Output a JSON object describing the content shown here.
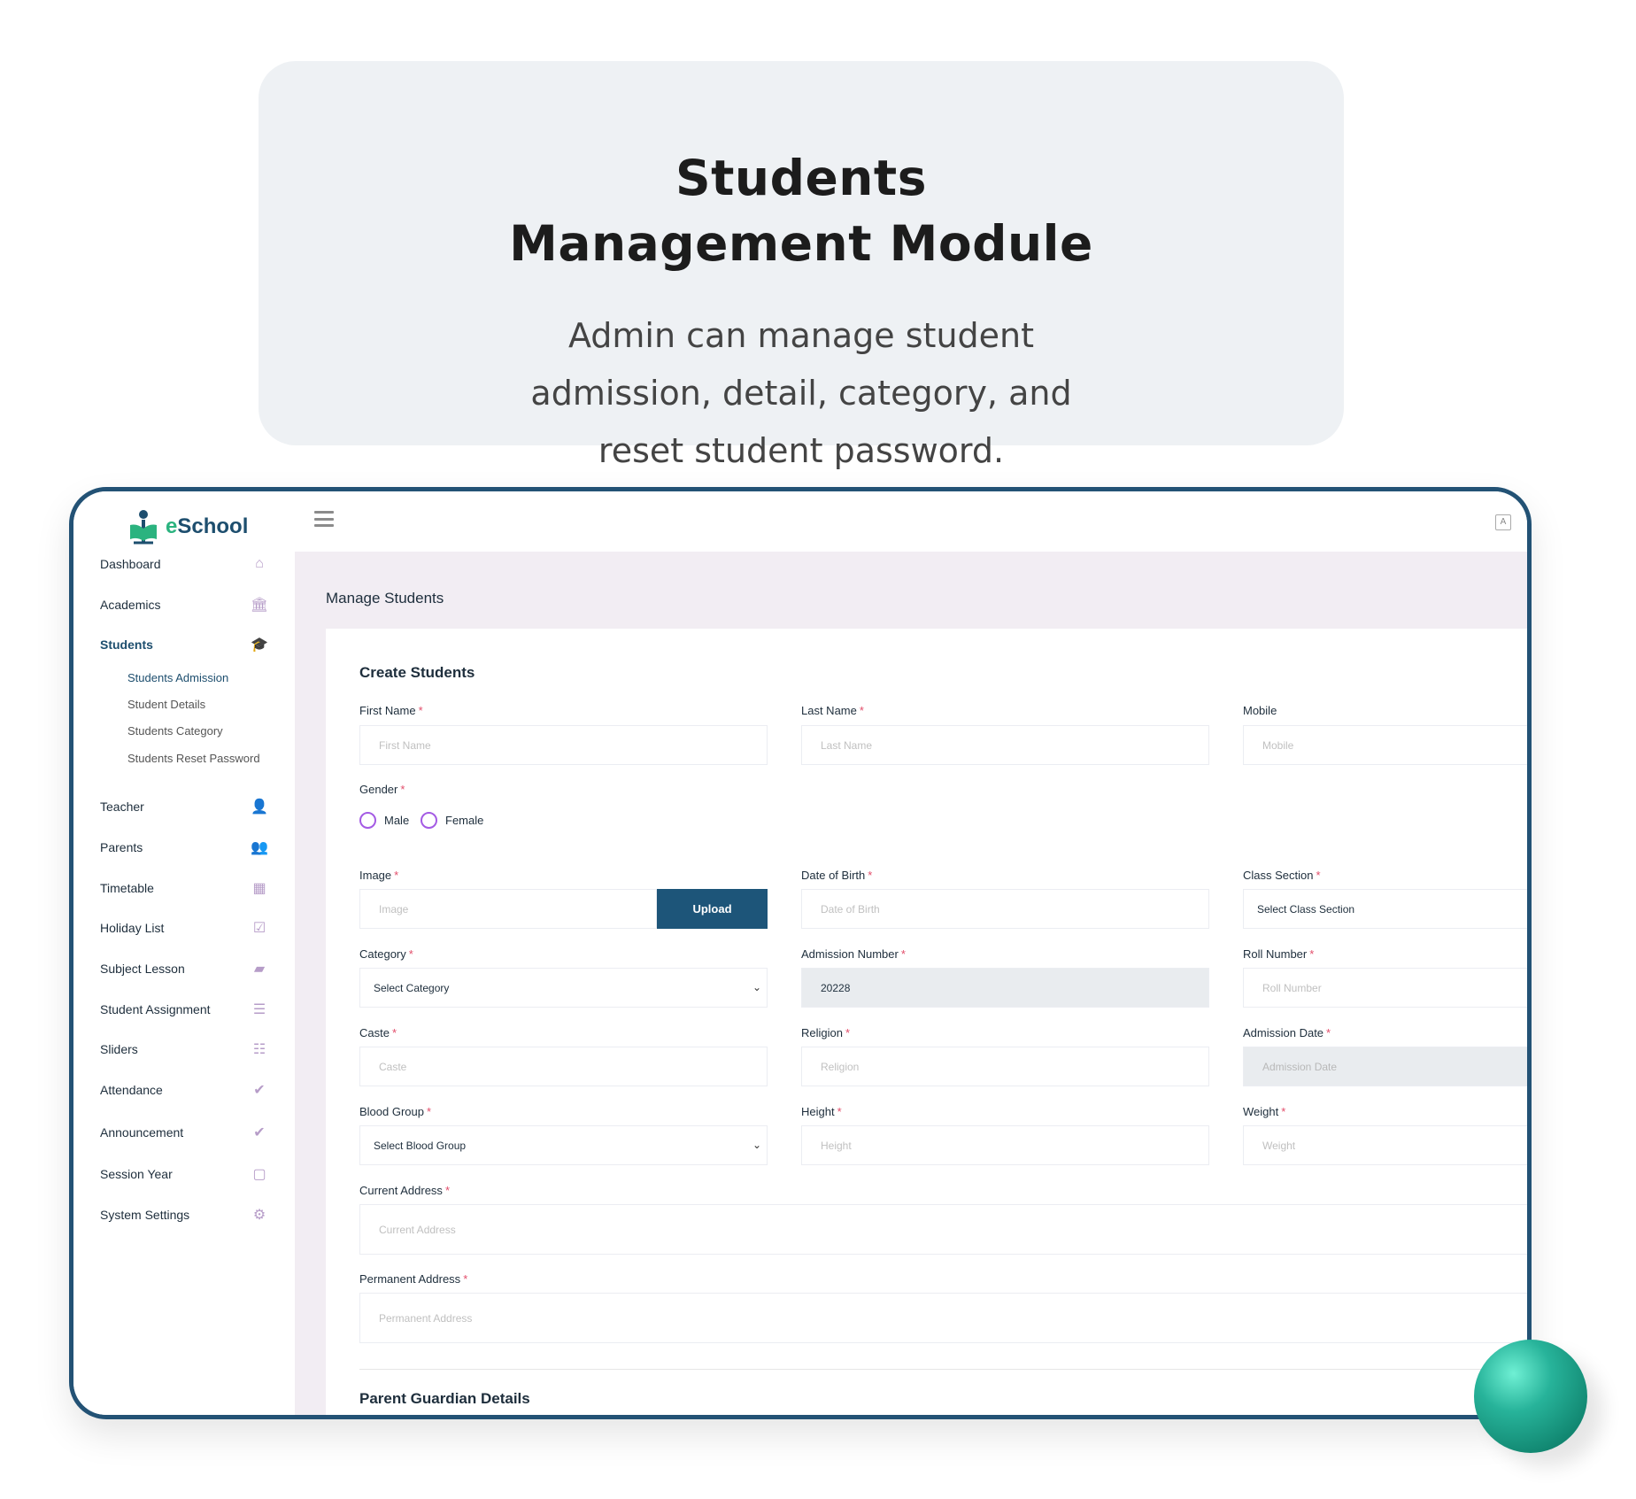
{
  "hero": {
    "title_line1": "Students",
    "title_line2": "Management Module",
    "description": "Admin can manage student admission, detail, category, and reset student password."
  },
  "app": {
    "logo_text_e": "e",
    "logo_text_rest": "School",
    "lang_icon": "translate-icon"
  },
  "sidebar": {
    "items": [
      {
        "label": "Dashboard",
        "icon": "home-icon",
        "glyph": "⌂"
      },
      {
        "label": "Academics",
        "icon": "institution-icon",
        "glyph": "🏛"
      },
      {
        "label": "Students",
        "icon": "graduation-cap-icon",
        "glyph": "🎓"
      },
      {
        "label": "Teacher",
        "icon": "user-icon",
        "glyph": "👤"
      },
      {
        "label": "Parents",
        "icon": "users-icon",
        "glyph": "👥"
      },
      {
        "label": "Timetable",
        "icon": "calendar-grid-icon",
        "glyph": "▦"
      },
      {
        "label": "Holiday List",
        "icon": "calendar-check-icon",
        "glyph": "☑"
      },
      {
        "label": "Subject Lesson",
        "icon": "book-icon",
        "glyph": "▰"
      },
      {
        "label": "Student Assignment",
        "icon": "tasks-icon",
        "glyph": "☰"
      },
      {
        "label": "Sliders",
        "icon": "list-icon",
        "glyph": "☷"
      },
      {
        "label": "Attendance",
        "icon": "check-icon",
        "glyph": "✔"
      },
      {
        "label": "Announcement",
        "icon": "check-icon",
        "glyph": "✔"
      },
      {
        "label": "Session Year",
        "icon": "calendar-icon",
        "glyph": "▢"
      },
      {
        "label": "System Settings",
        "icon": "gear-icon",
        "glyph": "⚙"
      }
    ],
    "students_sub": [
      "Students Admission",
      "Student Details",
      "Students Category",
      "Students Reset Password"
    ]
  },
  "page": {
    "title": "Manage Students",
    "card_title": "Create Students",
    "section2_title": "Parent Guardian Details"
  },
  "form": {
    "first_name": {
      "label": "First Name",
      "required": "*",
      "placeholder": "First Name"
    },
    "last_name": {
      "label": "Last Name",
      "required": "*",
      "placeholder": "Last Name"
    },
    "mobile": {
      "label": "Mobile",
      "placeholder": "Mobile"
    },
    "gender": {
      "label": "Gender",
      "required": "*",
      "options": [
        "Male",
        "Female"
      ]
    },
    "image": {
      "label": "Image",
      "required": "*",
      "placeholder": "Image",
      "button": "Upload"
    },
    "dob": {
      "label": "Date of Birth",
      "required": "*",
      "placeholder": "Date of Birth"
    },
    "class_section": {
      "label": "Class Section",
      "required": "*",
      "value": "Select Class Section"
    },
    "category": {
      "label": "Category",
      "required": "*",
      "value": "Select Category"
    },
    "admission_number": {
      "label": "Admission Number",
      "required": "*",
      "value": "20228"
    },
    "roll_number": {
      "label": "Roll Number",
      "required": "*",
      "placeholder": "Roll Number"
    },
    "caste": {
      "label": "Caste",
      "required": "*",
      "placeholder": "Caste"
    },
    "religion": {
      "label": "Religion",
      "required": "*",
      "placeholder": "Religion"
    },
    "admission_date": {
      "label": "Admission Date",
      "required": "*",
      "placeholder": "Admission Date"
    },
    "blood_group": {
      "label": "Blood Group",
      "required": "*",
      "value": "Select Blood Group"
    },
    "height": {
      "label": "Height",
      "required": "*",
      "placeholder": "Height"
    },
    "weight": {
      "label": "Weight",
      "required": "*",
      "placeholder": "Weight"
    },
    "current_address": {
      "label": "Current Address",
      "required": "*",
      "placeholder": "Current Address"
    },
    "permanent_address": {
      "label": "Permanent Address",
      "required": "*",
      "placeholder": "Permanent Address"
    }
  },
  "colors": {
    "primary": "#1d5579",
    "accent_green": "#2bb37f",
    "radio": "#a45be4",
    "required": "#e24d6a",
    "content_bg": "#f2edf3"
  }
}
